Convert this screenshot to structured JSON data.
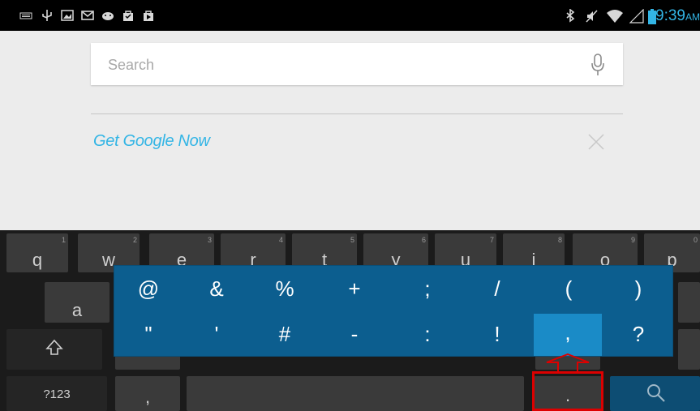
{
  "status_bar": {
    "time": "9:39",
    "ampm": "AM",
    "left_icons": [
      "keyboard-icon",
      "usb-icon",
      "image-icon",
      "gmail-icon",
      "android-icon",
      "shopping-bag-icon",
      "play-store-icon"
    ],
    "right_icons": [
      "bluetooth-icon",
      "mute-icon",
      "wifi-icon",
      "signal-icon",
      "battery-icon"
    ],
    "accent": "#33b5e5"
  },
  "search": {
    "placeholder": "Search"
  },
  "google_now": {
    "label": "Get Google Now"
  },
  "keyboard": {
    "row1": [
      {
        "label": "q",
        "hint": "1"
      },
      {
        "label": "w",
        "hint": "2"
      },
      {
        "label": "e",
        "hint": "3"
      },
      {
        "label": "r",
        "hint": "4"
      },
      {
        "label": "t",
        "hint": "5"
      },
      {
        "label": "y",
        "hint": "6"
      },
      {
        "label": "u",
        "hint": "7"
      },
      {
        "label": "i",
        "hint": "8"
      },
      {
        "label": "o",
        "hint": "9"
      },
      {
        "label": "p",
        "hint": "0"
      }
    ],
    "row2_first": "a",
    "mode_key": "?123",
    "comma_key": ",",
    "period_key": ".",
    "shift_icon": "shift-icon",
    "search_icon": "search-icon"
  },
  "popup": {
    "row1": [
      "@",
      "&",
      "%",
      "+",
      ";",
      "/",
      "(",
      ")"
    ],
    "row2": [
      "\"",
      "'",
      "#",
      "-",
      ":",
      "!",
      ",",
      "?"
    ],
    "selected": ","
  }
}
